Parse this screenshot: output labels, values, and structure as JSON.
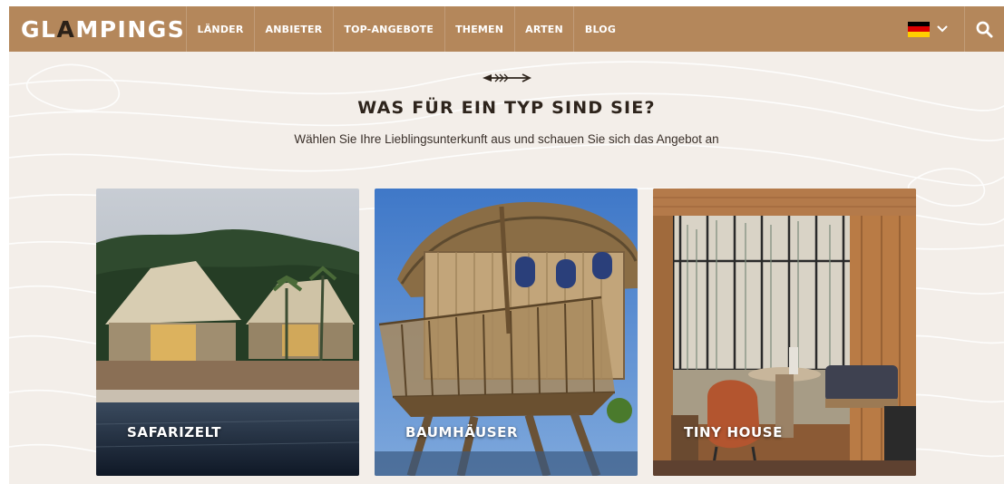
{
  "brand": {
    "logo_text_pre": "GL",
    "logo_text_mid": "A",
    "logo_text_post": "MPINGS"
  },
  "nav": {
    "items": [
      "LÄNDER",
      "ANBIETER",
      "TOP-ANGEBOTE",
      "THEMEN",
      "ARTEN",
      "BLOG"
    ]
  },
  "language": {
    "icon": "german-flag-icon",
    "flag_colors": [
      "#000000",
      "#dd0000",
      "#ffce00"
    ]
  },
  "search": {
    "icon": "search-icon"
  },
  "section": {
    "heading": "WAS FÜR EIN TYP SIND SIE?",
    "subheading": "Wählen Sie Ihre Lieblingsunterkunft aus und schauen Sie sich das Angebot an"
  },
  "cards": [
    {
      "label": "SAFARIZELT"
    },
    {
      "label": "BAUMHÄUSER"
    },
    {
      "label": "TINY HOUSE"
    }
  ],
  "colors": {
    "brand": "#b4875b",
    "background": "#f3eee9",
    "heading": "#2e241c"
  }
}
